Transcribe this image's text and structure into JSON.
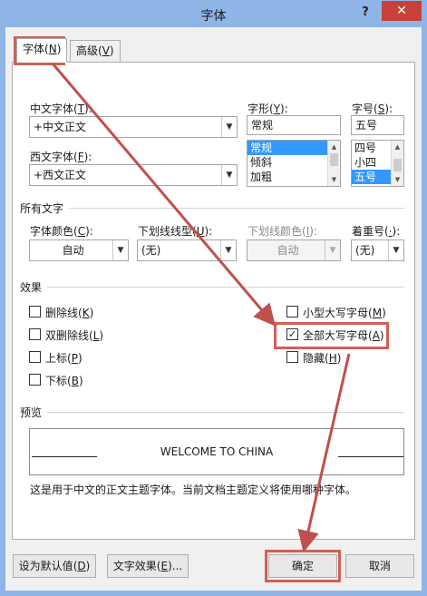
{
  "window": {
    "title": "字体",
    "help": "?",
    "close": "✕"
  },
  "tabs": [
    {
      "label": "字体",
      "key": "N"
    },
    {
      "label": "高级",
      "key": "V"
    }
  ],
  "font": {
    "cn_label": "中文字体",
    "cn_key": "T",
    "cn_value": "+中文正文",
    "west_label": "西文字体",
    "west_key": "F",
    "west_value": "+西文正文",
    "style_label": "字形",
    "style_key": "Y",
    "style_value": "常规",
    "style_options": [
      "常规",
      "倾斜",
      "加粗"
    ],
    "size_label": "字号",
    "size_key": "S",
    "size_value": "五号",
    "size_options": [
      "四号",
      "小四",
      "五号"
    ]
  },
  "all_text": {
    "section": "所有文字",
    "color_label": "字体颜色",
    "color_key": "C",
    "color_value": "自动",
    "underline_label": "下划线线型",
    "underline_key": "U",
    "underline_value": "(无)",
    "ucolor_label": "下划线颜色",
    "ucolor_key": "I",
    "ucolor_value": "自动",
    "emph_label": "着重号",
    "emph_key": "·",
    "emph_value": "(无)"
  },
  "effects": {
    "section": "效果",
    "strike": {
      "label": "删除线",
      "key": "K"
    },
    "dstrike": {
      "label": "双删除线",
      "key": "L"
    },
    "sup": {
      "label": "上标",
      "key": "P"
    },
    "sub": {
      "label": "下标",
      "key": "B"
    },
    "smallcaps": {
      "label": "小型大写字母",
      "key": "M"
    },
    "allcaps": {
      "label": "全部大写字母",
      "key": "A",
      "check": "✓"
    },
    "hidden": {
      "label": "隐藏",
      "key": "H"
    }
  },
  "preview": {
    "section": "预览",
    "sample": "WELCOME TO CHINA",
    "note": "这是用于中文的正文主题字体。当前文档主题定义将使用哪种字体。"
  },
  "buttons": {
    "default": {
      "label": "设为默认值",
      "key": "D"
    },
    "effects": {
      "label": "文字效果",
      "key": "E",
      "suffix": "..."
    },
    "ok": "确定",
    "cancel": "取消"
  },
  "colors": {
    "highlight": "#d06056",
    "selection": "#3399ff",
    "titlebar": "#8fb4e6",
    "close": "#c7403a"
  }
}
